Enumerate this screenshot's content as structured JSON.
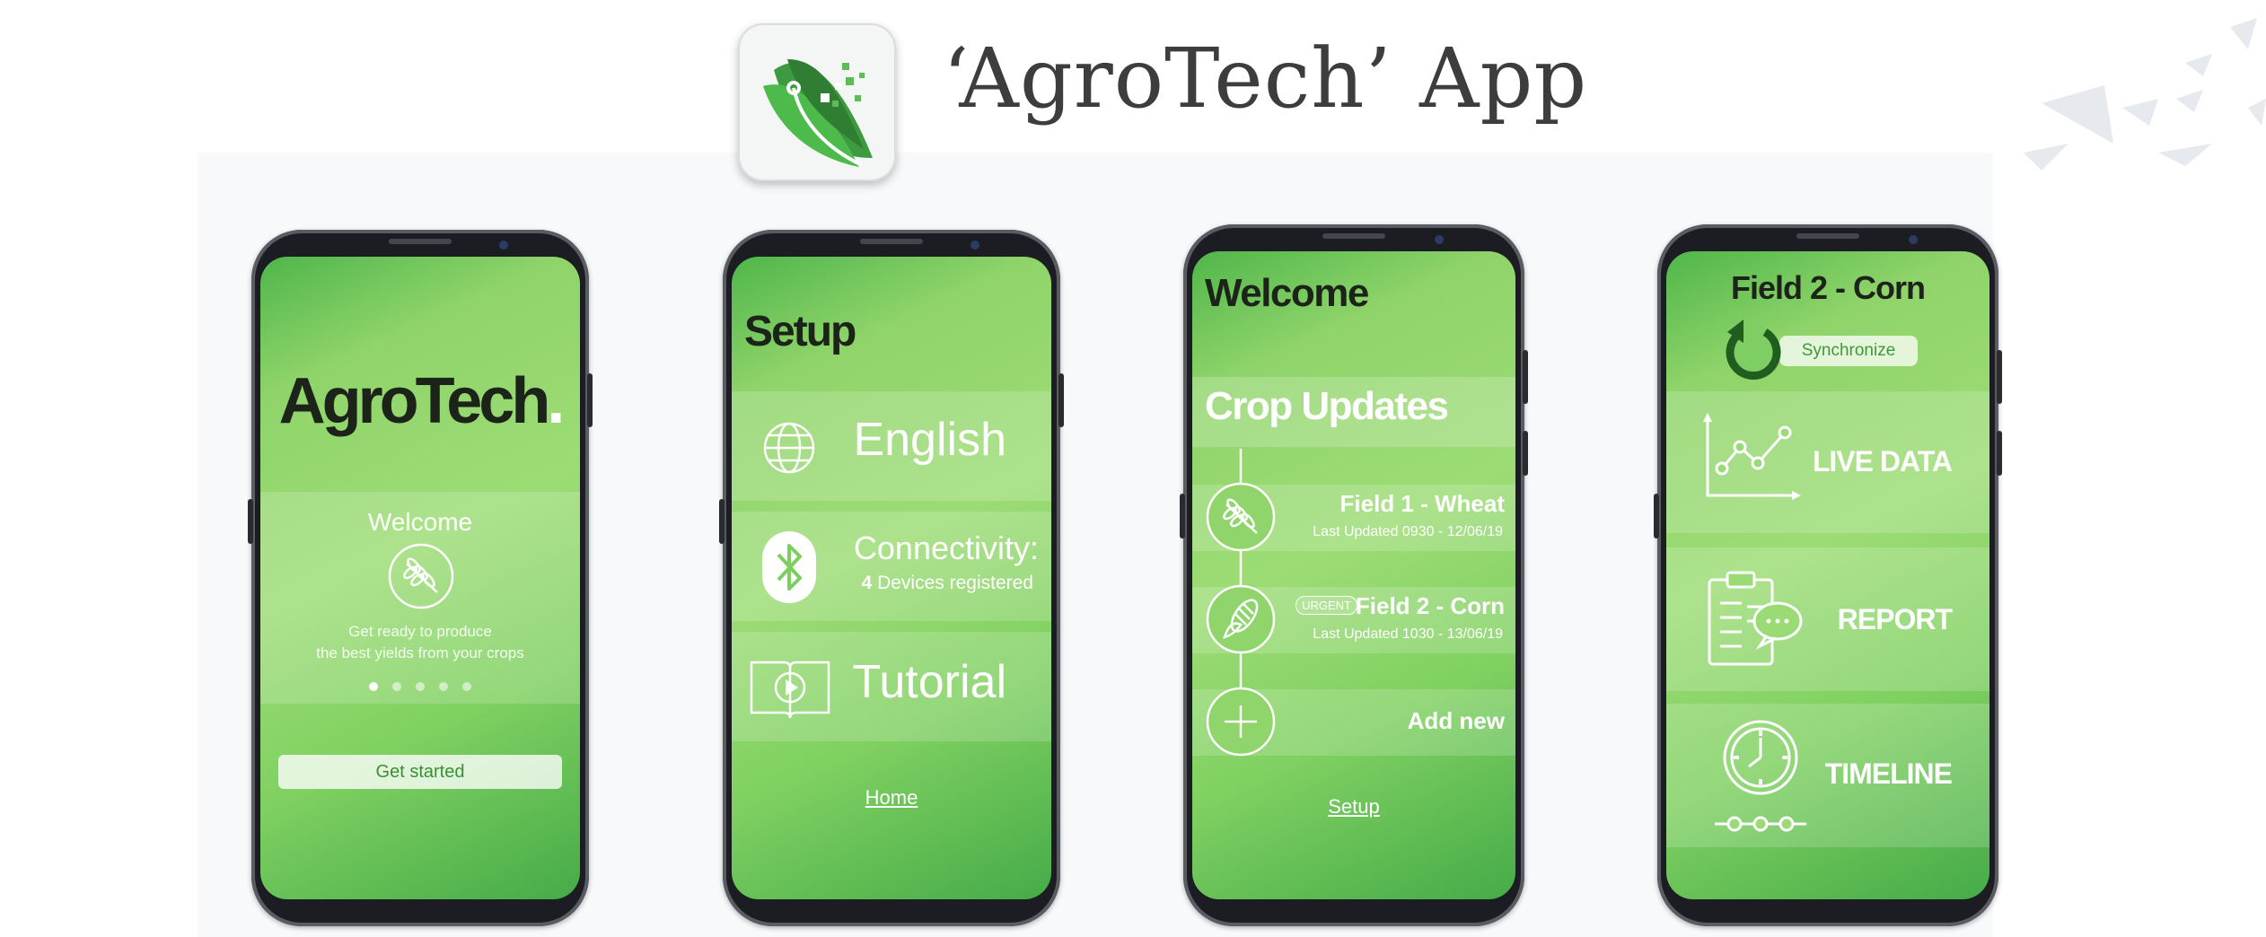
{
  "header": {
    "title": "‘AgroTech’ App"
  },
  "colors": {
    "brand_green": "#7ed160",
    "dark_text": "#1c2319",
    "header_text": "#3d3d3d"
  },
  "phone1": {
    "brand_main": "AgroTech",
    "brand_dot": ".",
    "welcome": "Welcome",
    "subtitle": "Get ready to produce\nthe best yields from your crops",
    "pager": {
      "count": 5,
      "active": 1
    },
    "button": "Get started"
  },
  "phone2": {
    "title": "Setup",
    "items": [
      {
        "icon": "globe-icon",
        "label": "English"
      },
      {
        "icon": "bluetooth-icon",
        "label": "Connectivity:",
        "detail_count": "4",
        "detail_text": " Devices registered"
      },
      {
        "icon": "tutorial-book-icon",
        "label": "Tutorial"
      }
    ],
    "link": "Home"
  },
  "phone3": {
    "title": "Welcome",
    "section": "Crop Updates",
    "fields": [
      {
        "icon": "wheat-icon",
        "name": "Field 1 - Wheat",
        "updated": "Last Updated 0930 - 12/06/19",
        "badge": ""
      },
      {
        "icon": "corn-icon",
        "name": "Field 2 - Corn",
        "updated": "Last Updated 1030 - 13/06/19",
        "badge": "URGENT"
      }
    ],
    "add_new": "Add new",
    "link": "Setup"
  },
  "phone4": {
    "title": "Field 2 - Corn",
    "sync": "Synchronize",
    "items": [
      {
        "icon": "line-chart-icon",
        "label": "LIVE DATA"
      },
      {
        "icon": "report-clipboard-icon",
        "label": "REPORT"
      },
      {
        "icon": "timeline-clock-icon",
        "label": "TIMELINE"
      }
    ]
  }
}
